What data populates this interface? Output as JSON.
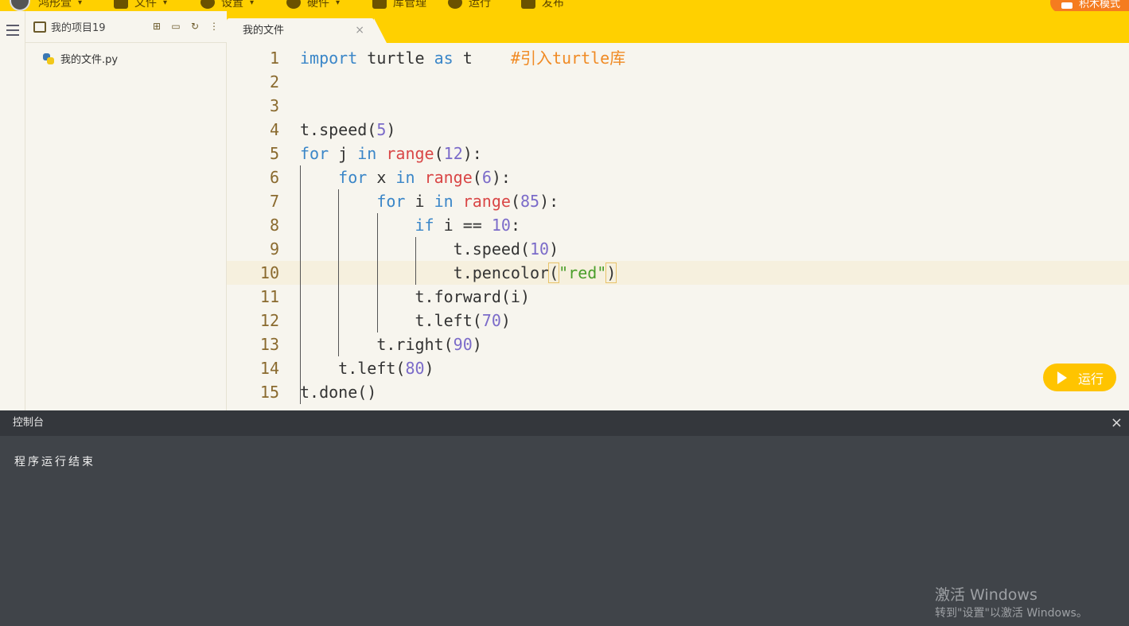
{
  "topbar": {
    "user": "鸿彤萱",
    "menus": [
      "文件",
      "设置",
      "硬件",
      "库管理",
      "运行",
      "发布"
    ],
    "blocks_mode": "积木模式"
  },
  "project": {
    "title": "我的项目19",
    "files": [
      "我的文件.py"
    ]
  },
  "tab": {
    "label": "我的文件",
    "close": "×"
  },
  "editor": {
    "line_numbers": [
      "1",
      "2",
      "3",
      "4",
      "5",
      "6",
      "7",
      "8",
      "9",
      "10",
      "11",
      "12",
      "13",
      "14",
      "15"
    ]
  },
  "run_button": "运行",
  "console": {
    "title": "控制台",
    "close": "×",
    "output": "程序运行结束"
  },
  "watermark": {
    "line1": "激活 Windows",
    "line2": "转到\"设置\"以激活 Windows。"
  }
}
